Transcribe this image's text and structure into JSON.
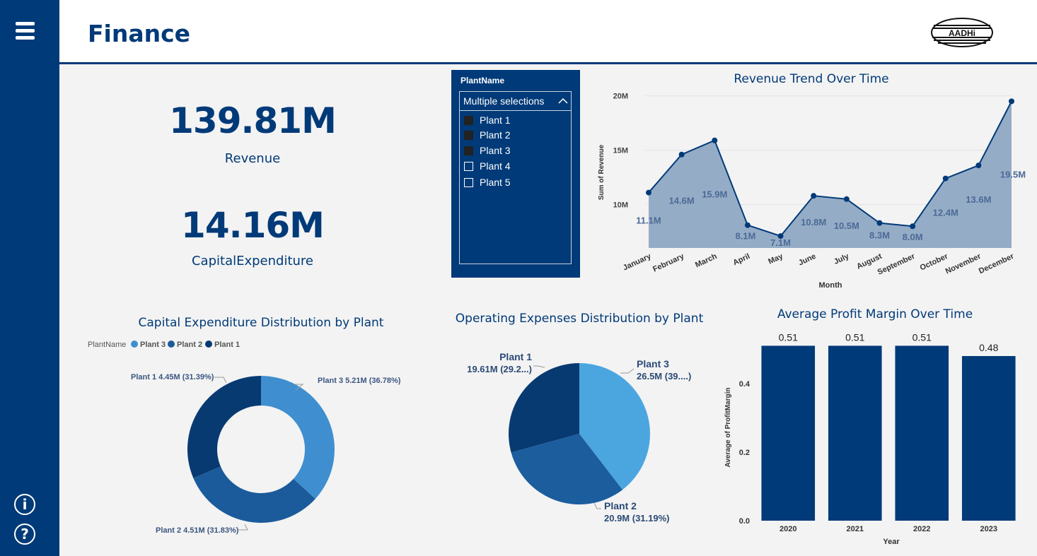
{
  "page": {
    "title": "Finance"
  },
  "logo": {
    "text": "AADHi"
  },
  "kpis": {
    "revenue": {
      "value": "139.81M",
      "label": "Revenue"
    },
    "capex": {
      "value": "14.16M",
      "label": "CapitalExpenditure"
    }
  },
  "slicer": {
    "title": "PlantName",
    "selected": "Multiple selections",
    "items": [
      {
        "label": "Plant 1",
        "checked": true
      },
      {
        "label": "Plant 2",
        "checked": true
      },
      {
        "label": "Plant 3",
        "checked": true
      },
      {
        "label": "Plant 4",
        "checked": false
      },
      {
        "label": "Plant 5",
        "checked": false
      }
    ]
  },
  "colors": {
    "primary": "#003a78",
    "accent_light": "#4aa3df",
    "accent_mid": "#1c5d9e",
    "area_fill": "#8fa8c4",
    "background": "#f3f3f3"
  },
  "chart_data": [
    {
      "id": "revenue_trend",
      "type": "area",
      "title": "Revenue Trend Over Time",
      "xlabel": "Month",
      "ylabel": "Sum of Revenue",
      "categories": [
        "January",
        "February",
        "March",
        "April",
        "May",
        "June",
        "July",
        "August",
        "September",
        "October",
        "November",
        "December"
      ],
      "values": [
        11.1,
        14.6,
        15.9,
        8.1,
        7.1,
        10.8,
        10.5,
        8.3,
        8.0,
        12.4,
        13.6,
        19.5
      ],
      "data_labels": [
        "11.1M",
        "14.6M",
        "15.9M",
        "8.1M",
        "7.1M",
        "10.8M",
        "10.5M",
        "8.3M",
        "8.0M",
        "12.4M",
        "13.6M",
        "19.5M"
      ],
      "yticks": [
        "10M",
        "15M",
        "20M"
      ],
      "ytick_values": [
        10,
        15,
        20
      ],
      "ylim": [
        6,
        20.5
      ],
      "grid": true
    },
    {
      "id": "capex_by_plant",
      "type": "pie",
      "variant": "donut",
      "title": "Capital Expenditure Distribution by Plant",
      "legend_title": "PlantName",
      "legend": [
        "Plant 3",
        "Plant 2",
        "Plant 1"
      ],
      "legend_position": "top-left",
      "slices": [
        {
          "name": "Plant 3",
          "value": 5.21,
          "label": "Plant 3 5.21M (36.78%)",
          "color": "#3f8fd0"
        },
        {
          "name": "Plant 2",
          "value": 4.51,
          "label": "Plant 2 4.51M (31.83%)",
          "color": "#1b5b9b"
        },
        {
          "name": "Plant 1",
          "value": 4.45,
          "label": "Plant 1 4.45M (31.39%)",
          "color": "#083a72"
        }
      ]
    },
    {
      "id": "opex_by_plant",
      "type": "pie",
      "title": "Operating Expenses Distribution by Plant",
      "slices": [
        {
          "name": "Plant 3",
          "value": 26.5,
          "label_line1": "Plant 3",
          "label_line2": "26.5M (39....)",
          "color": "#4ba6e0"
        },
        {
          "name": "Plant 2",
          "value": 20.9,
          "label_line1": "Plant 2",
          "label_line2": "20.9M (31.19%)",
          "color": "#1c5d9e"
        },
        {
          "name": "Plant 1",
          "value": 19.61,
          "label_line1": "Plant 1",
          "label_line2": "19.61M (29.2...)",
          "color": "#083a72"
        }
      ]
    },
    {
      "id": "profit_margin",
      "type": "bar",
      "title": "Average Profit Margin Over Time",
      "xlabel": "Year",
      "ylabel": "Average of ProfitMargin",
      "categories": [
        "2020",
        "2021",
        "2022",
        "2023"
      ],
      "values": [
        0.51,
        0.51,
        0.51,
        0.48
      ],
      "data_labels": [
        "0.51",
        "0.51",
        "0.51",
        "0.48"
      ],
      "yticks": [
        "0.0",
        "0.2",
        "0.4"
      ],
      "ytick_values": [
        0,
        0.2,
        0.4
      ],
      "ylim": [
        0,
        0.55
      ],
      "grid": false
    }
  ]
}
